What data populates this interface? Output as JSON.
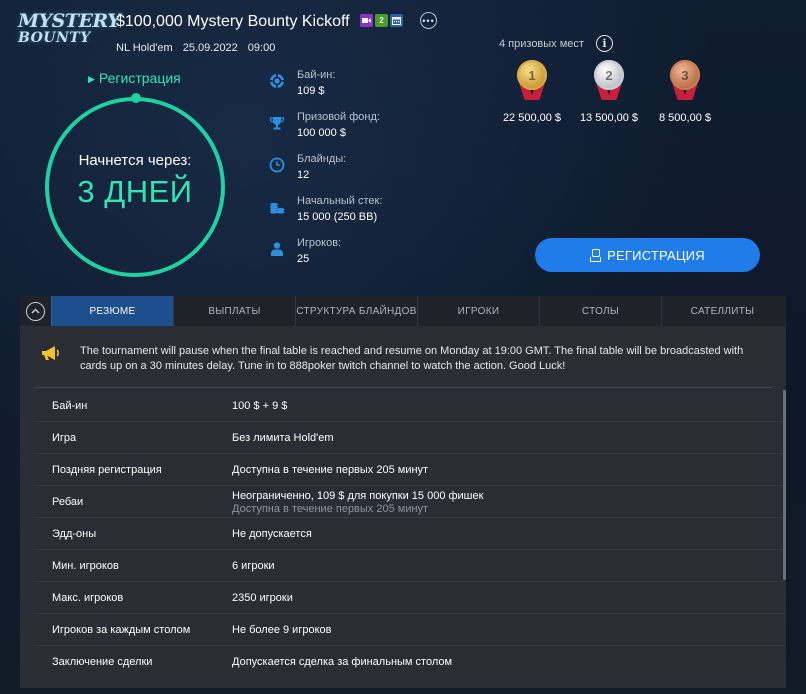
{
  "logo": {
    "line1": "MYSTERY",
    "line2": "BOUNTY"
  },
  "tournament": {
    "title": "$100,000 Mystery Bounty Kickoff",
    "game": "NL Hold'em",
    "date": "25.09.2022",
    "time": "09:00",
    "badges": [
      {
        "icon": "video-icon",
        "color": "#8a33c9"
      },
      {
        "icon": "reentry-icon",
        "text": "2",
        "color": "#4c9a2a"
      },
      {
        "icon": "calendar-icon",
        "color": "#2c5fb8"
      }
    ]
  },
  "registration_link": "Регистрация",
  "countdown": {
    "label": "Начнется через:",
    "value": "3 ДНЕЙ",
    "accent": "#1fd0a0"
  },
  "info": [
    {
      "icon": "chip-icon",
      "label": "Бай-ин:",
      "value": "109 $"
    },
    {
      "icon": "trophy-icon",
      "label": "Призовой фонд:",
      "value": "100 000 $"
    },
    {
      "icon": "clock-icon",
      "label": "Блайнды:",
      "value": "12"
    },
    {
      "icon": "chip-stack-icon",
      "label": "Начальный стек:",
      "value": "15 000 (250 BB)"
    },
    {
      "icon": "player-icon",
      "label": "Игроков:",
      "value": "25"
    }
  ],
  "prizes": {
    "heading": "4 призовых мест",
    "items": [
      {
        "place": "1",
        "amount": "22 500,00 $",
        "medal": "gold"
      },
      {
        "place": "2",
        "amount": "13 500,00 $",
        "medal": "silver"
      },
      {
        "place": "3",
        "amount": "8 500,00 $",
        "medal": "bronze"
      }
    ]
  },
  "register_button": "РЕГИСТРАЦИЯ",
  "tabs": [
    "РЕЗЮМЕ",
    "ВЫПЛАТЫ",
    "СТРУКТУРА БЛАЙНДОВ",
    "ИГРОКИ",
    "СТОЛЫ",
    "САТЕЛЛИТЫ"
  ],
  "active_tab": "РЕЗЮМЕ",
  "notice": "The tournament will pause when the final table is reached and resume on Monday at 19:00 GMT. The final table will be broadcasted with cards up on a 30 minutes delay. Tune in to 888poker twitch channel to watch the action. Good Luck!",
  "details": [
    {
      "label": "Бай-ин",
      "value": "100 $ + 9 $"
    },
    {
      "label": "Игра",
      "value": "Без лимита Hold'em"
    },
    {
      "label": "Поздняя регистрация",
      "value": "Доступна в течение первых 205 минут"
    },
    {
      "label": "Ребаи",
      "value": "Неограниченно, 109 $ для покупки 15 000 фишек",
      "sub": "Доступна в течение первых 205 минут"
    },
    {
      "label": "Эдд-оны",
      "value": "Не допускается"
    },
    {
      "label": "Мин. игроков",
      "value": "6 игроки"
    },
    {
      "label": "Макс. игроков",
      "value": "2350 игроки"
    },
    {
      "label": "Игроков за каждым столом",
      "value": "Не более 9 игроков"
    },
    {
      "label": "Заключение сделки",
      "value": "Допускается сделка за финальным столом"
    }
  ]
}
